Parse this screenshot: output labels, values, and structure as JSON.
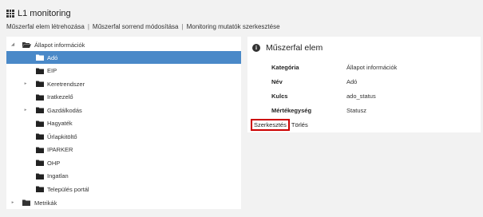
{
  "header": {
    "title": "L1 monitoring",
    "icon": "grid-icon"
  },
  "toolbar": {
    "create_label": "Műszerfal elem létrehozása",
    "reorder_label": "Műszerfal sorrend módosítása",
    "metrics_label": "Monitoring mutatók szerkesztése",
    "separator": "|"
  },
  "tree": {
    "root": {
      "label": "Állapot információk",
      "expanded": true
    },
    "items": [
      {
        "label": "Adó",
        "selected": true,
        "has_children": false
      },
      {
        "label": "EIP",
        "selected": false,
        "has_children": false
      },
      {
        "label": "Keretrendszer",
        "selected": false,
        "has_children": true
      },
      {
        "label": "Iratkezelő",
        "selected": false,
        "has_children": false
      },
      {
        "label": "Gazdálkodás",
        "selected": false,
        "has_children": true
      },
      {
        "label": "Hagyaték",
        "selected": false,
        "has_children": false
      },
      {
        "label": "Űrlapkitöltő",
        "selected": false,
        "has_children": false
      },
      {
        "label": "IPARKER",
        "selected": false,
        "has_children": false
      },
      {
        "label": "OHP",
        "selected": false,
        "has_children": false
      },
      {
        "label": "Ingatlan",
        "selected": false,
        "has_children": false
      },
      {
        "label": "Település portál",
        "selected": false,
        "has_children": false
      }
    ],
    "bottom": {
      "label": "Metrikák",
      "expanded": false
    }
  },
  "detail": {
    "title": "Műszerfal elem",
    "icon": "info-icon",
    "fields": [
      {
        "label": "Kategória",
        "value": "Állapot információk"
      },
      {
        "label": "Név",
        "value": "Adó"
      },
      {
        "label": "Kulcs",
        "value": "ado_status"
      },
      {
        "label": "Mértékegység",
        "value": "Statusz"
      }
    ],
    "edit_label": "Szerkesztés",
    "delete_label": "Törlés"
  },
  "colors": {
    "selected_bg": "#4a89c8",
    "highlight_border": "#cc0000",
    "page_bg": "#f2f2f2"
  }
}
